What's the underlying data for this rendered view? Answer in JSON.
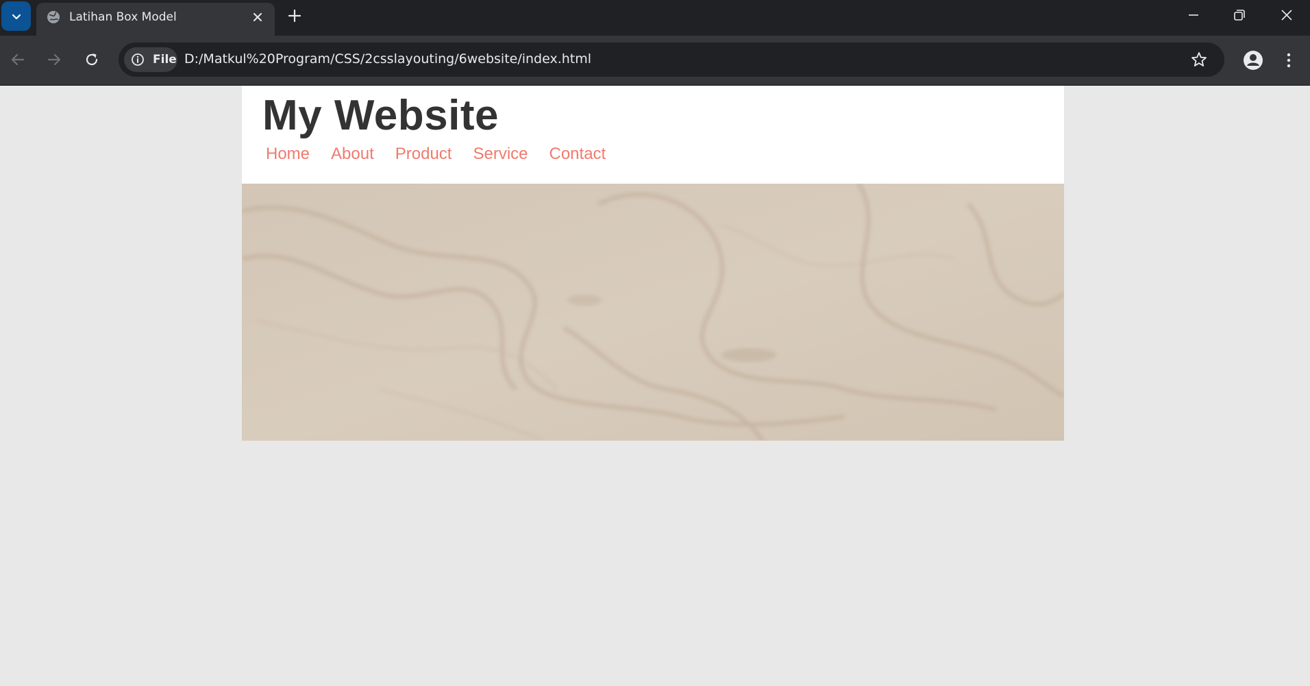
{
  "browser": {
    "tab": {
      "title": "Latihan Box Model"
    },
    "address": {
      "site_chip_label": "File",
      "url": "D:/Matkul%20Program/CSS/2csslayouting/6website/index.html"
    }
  },
  "page": {
    "site_title": "My Website",
    "nav": [
      {
        "label": "Home"
      },
      {
        "label": "About"
      },
      {
        "label": "Product"
      },
      {
        "label": "Service"
      },
      {
        "label": "Contact"
      }
    ],
    "colors": {
      "background": "#e8e8e8",
      "header_bg": "#ffffff",
      "title_color": "#333333",
      "nav_link": "#f07a6e",
      "hero_wood": "#d6cabb"
    }
  }
}
